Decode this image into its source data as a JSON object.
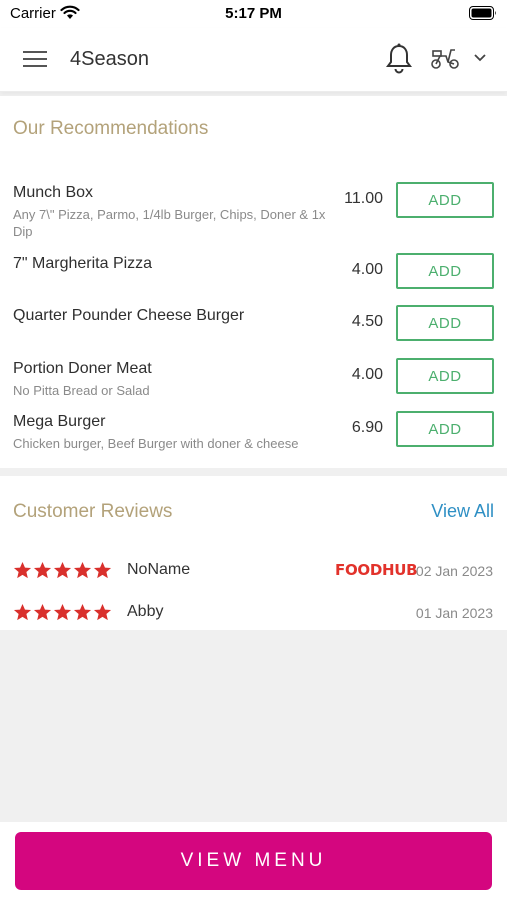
{
  "status_bar": {
    "carrier": "Carrier",
    "time": "5:17 PM",
    "icons": [
      "wifi-icon",
      "battery-icon"
    ]
  },
  "header": {
    "title": "4Season",
    "icons": [
      "menu-icon",
      "bell-icon",
      "scooter-icon",
      "chevron-down-icon"
    ]
  },
  "recommendations": {
    "title": "Our Recommendations",
    "add_label": "ADD",
    "items": [
      {
        "name": "Munch Box",
        "description": "Any 7\\\" Pizza, Parmo, 1/4lb Burger, Chips, Doner & 1x Dip",
        "price": "11.00"
      },
      {
        "name": "7\" Margherita Pizza",
        "description": "",
        "price": "4.00"
      },
      {
        "name": "Quarter Pounder Cheese Burger",
        "description": "",
        "price": "4.50"
      },
      {
        "name": "Portion Doner Meat",
        "description": "No Pitta Bread or Salad",
        "price": "4.00"
      },
      {
        "name": "Mega Burger",
        "description": "Chicken burger, Beef Burger with doner & cheese",
        "price": "6.90"
      }
    ]
  },
  "reviews": {
    "title": "Customer Reviews",
    "view_all": "View All",
    "items": [
      {
        "name": "NoName",
        "rating": 5,
        "source": "FOODHUB",
        "date": "02 Jan 2023"
      },
      {
        "name": "Abby",
        "rating": 5,
        "source": "",
        "date": "01 Jan 2023"
      }
    ]
  },
  "bottom": {
    "view_menu_label": "VIEW MENU"
  },
  "colors": {
    "accent_gold": "#b3a27a",
    "add_green": "#4caf6e",
    "link_blue": "#2e8fc4",
    "star_red": "#d9302c",
    "brand_magenta": "#d4067f"
  }
}
